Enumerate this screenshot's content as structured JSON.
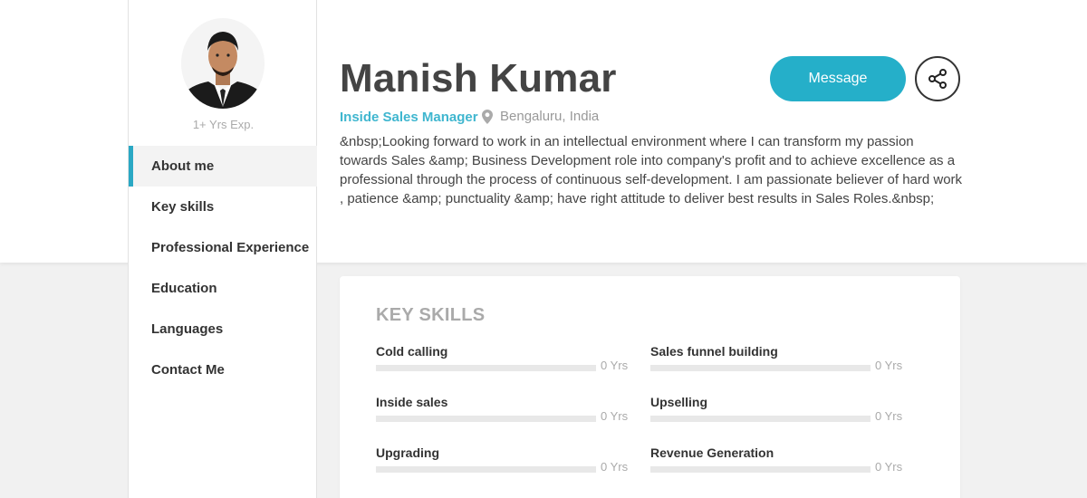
{
  "profile": {
    "name": "Manish Kumar",
    "role": "Inside Sales Manager",
    "location": "Bengaluru, India",
    "experience": "1+ Yrs Exp.",
    "about": "&nbsp;Looking forward to work in an intellectual environment where I can transform my passion towards Sales &amp; Business Development role into company's profit and to achieve excellence as a professional through the process of continuous self-development. I am passionate believer of hard work , patience &amp; punctuality &amp; have right attitude to deliver best results in Sales Roles.&nbsp;"
  },
  "actions": {
    "message_label": "Message",
    "share_icon": "share-icon"
  },
  "sidebar": {
    "items": [
      {
        "label": "About me"
      },
      {
        "label": "Key skills"
      },
      {
        "label": "Professional Experience"
      },
      {
        "label": "Education"
      },
      {
        "label": "Languages"
      },
      {
        "label": "Contact Me"
      }
    ]
  },
  "skills": {
    "title": "KEY SKILLS",
    "items": [
      {
        "name": "Cold calling",
        "years": "0 Yrs",
        "level": 0
      },
      {
        "name": "Sales funnel building",
        "years": "0 Yrs",
        "level": 0
      },
      {
        "name": "Inside sales",
        "years": "0 Yrs",
        "level": 0
      },
      {
        "name": "Upselling",
        "years": "0 Yrs",
        "level": 0
      },
      {
        "name": "Upgrading",
        "years": "0 Yrs",
        "level": 0
      },
      {
        "name": "Revenue Generation",
        "years": "0 Yrs",
        "level": 0
      }
    ]
  },
  "colors": {
    "accent": "#25afc9",
    "role": "#3fb6cf",
    "background": "#f1f1f1"
  }
}
